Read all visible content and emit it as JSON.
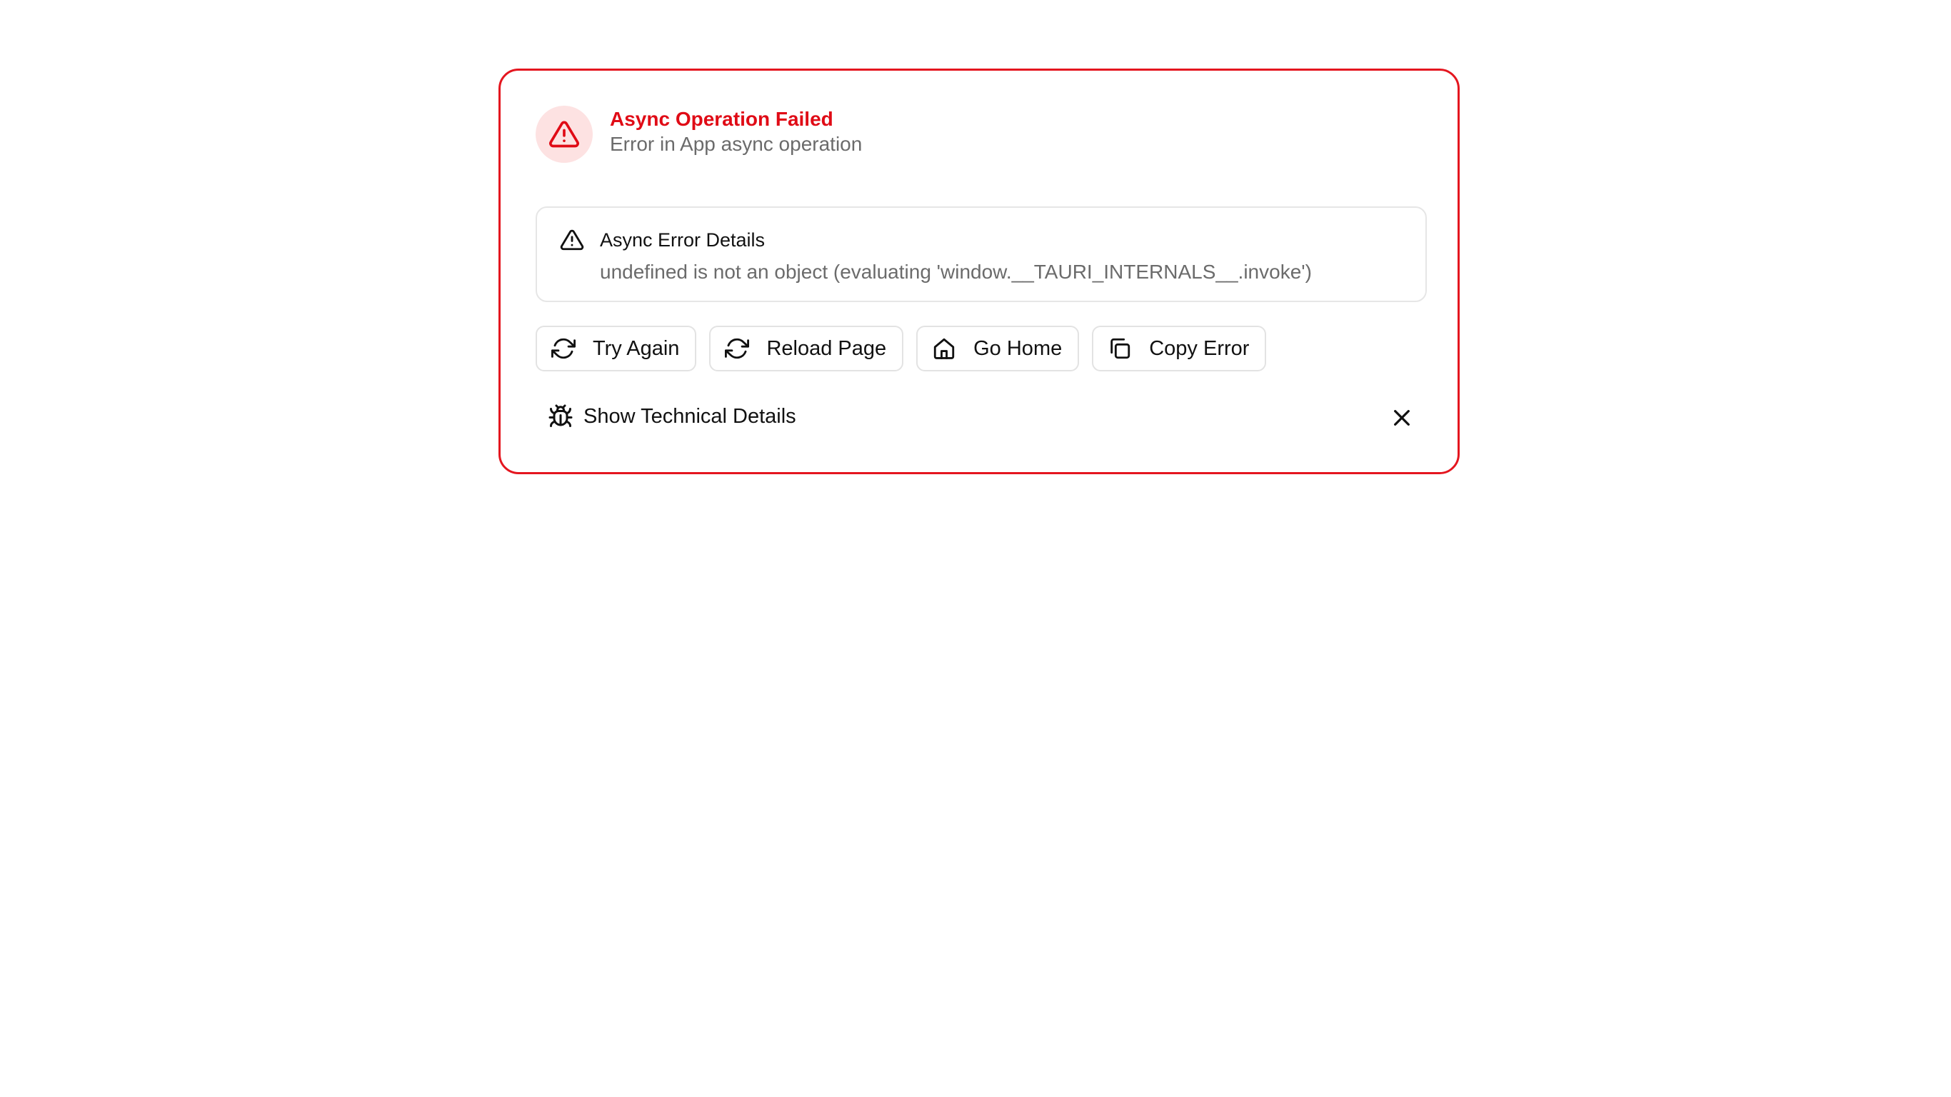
{
  "colors": {
    "accent": "#e00b16",
    "border": "#e4161f",
    "icon_bg": "#fde2e2",
    "muted_text": "#6b6b6b"
  },
  "header": {
    "icon": "alert-triangle-icon",
    "title": "Async Operation Failed",
    "subtitle": "Error in App async operation"
  },
  "details": {
    "icon": "alert-triangle-icon",
    "title": "Async Error Details",
    "message": "undefined is not an object (evaluating 'window.__TAURI_INTERNALS__.invoke')"
  },
  "actions": [
    {
      "label": "Try Again",
      "icon": "refresh-icon"
    },
    {
      "label": "Reload Page",
      "icon": "refresh-icon"
    },
    {
      "label": "Go Home",
      "icon": "home-icon"
    },
    {
      "label": "Copy Error",
      "icon": "copy-icon"
    }
  ],
  "technical": {
    "label": "Show Technical Details",
    "icon": "bug-icon"
  },
  "close": {
    "icon": "close-icon"
  }
}
